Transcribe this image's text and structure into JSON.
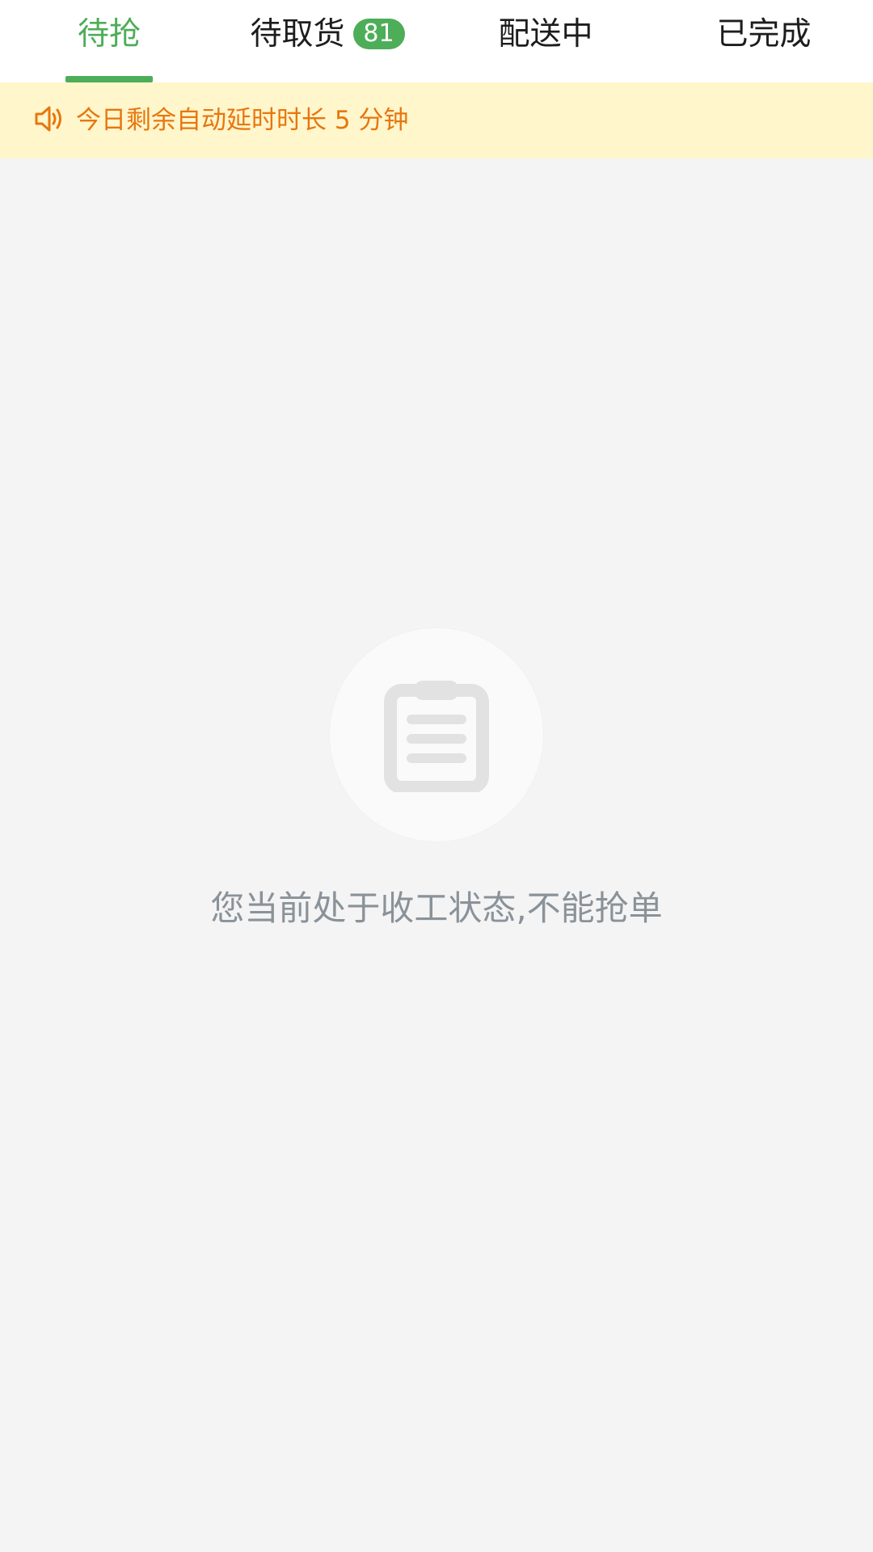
{
  "tabs": {
    "items": [
      {
        "label": "待抢",
        "active": true
      },
      {
        "label": "待取货",
        "badge": "81"
      },
      {
        "label": "配送中"
      },
      {
        "label": "已完成"
      }
    ],
    "accent_color": "#4ead58"
  },
  "notice": {
    "icon": "speaker-icon",
    "text": "今日剩余自动延时时长 5 分钟",
    "color": "#e8760e",
    "background": "#fff6cc"
  },
  "empty_state": {
    "icon": "clipboard-icon",
    "message": "您当前处于收工状态,不能抢单"
  }
}
